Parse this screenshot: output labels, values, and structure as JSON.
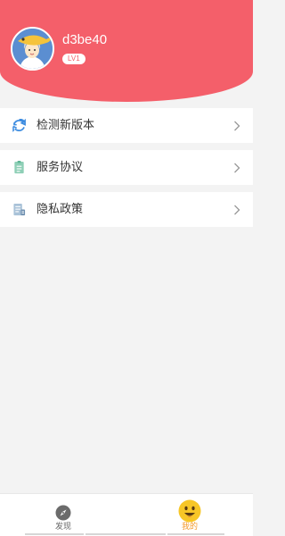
{
  "colors": {
    "header_bg": "#f45f6a",
    "accent_blue": "#3d8ce0",
    "text": "#333333",
    "active_tab": "#f39a2c"
  },
  "profile": {
    "username": "d3be40",
    "level": "LV1",
    "avatar_icon": "cartoon-avatar"
  },
  "menu": {
    "items": [
      {
        "label": "检测新版本",
        "icon": "refresh-icon"
      },
      {
        "label": "服务协议",
        "icon": "document-icon"
      },
      {
        "label": "隐私政策",
        "icon": "privacy-document-icon"
      }
    ]
  },
  "bottom_nav": {
    "tabs": [
      {
        "label": "发现",
        "icon": "compass-icon",
        "active": false
      },
      {
        "label": "我的",
        "icon": "smiley-icon",
        "active": true
      }
    ]
  }
}
